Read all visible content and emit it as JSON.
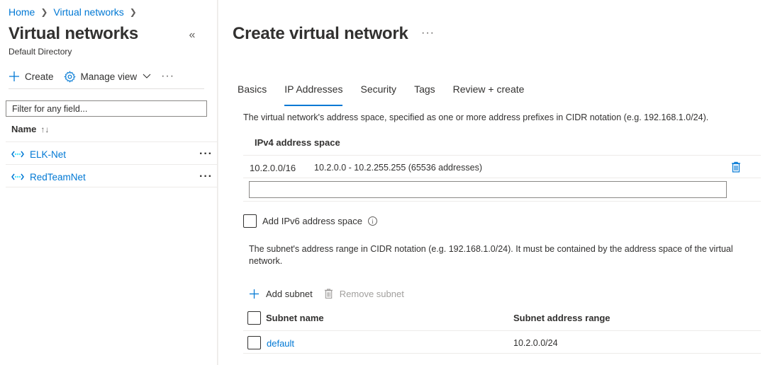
{
  "breadcrumb": {
    "home": "Home",
    "current": "Virtual networks"
  },
  "left_blade": {
    "title": "Virtual networks",
    "subtitle": "Default Directory",
    "commands": {
      "create": "Create",
      "manage_view": "Manage view"
    },
    "filter_placeholder": "Filter for any field...",
    "column_name": "Name",
    "items": [
      {
        "name": "ELK-Net"
      },
      {
        "name": "RedTeamNet"
      }
    ]
  },
  "right_blade": {
    "title": "Create virtual network",
    "tabs": [
      {
        "label": "Basics",
        "active": false
      },
      {
        "label": "IP Addresses",
        "active": true
      },
      {
        "label": "Security",
        "active": false
      },
      {
        "label": "Tags",
        "active": false
      },
      {
        "label": "Review + create",
        "active": false
      }
    ],
    "address_space_description": "The virtual network's address space, specified as one or more address prefixes in CIDR notation (e.g. 192.168.1.0/24).",
    "ipv4_header": "IPv4 address space",
    "ipv4_rows": [
      {
        "prefix": "10.2.0.0/16",
        "range": "10.2.0.0 - 10.2.255.255 (65536 addresses)"
      }
    ],
    "new_address_value": "",
    "ipv6_label": "Add IPv6 address space",
    "subnet_description": "The subnet's address range in CIDR notation (e.g. 192.168.1.0/24). It must be contained by the address space of the virtual network.",
    "add_subnet": "Add subnet",
    "remove_subnet": "Remove subnet",
    "subnet_table": {
      "headers": {
        "name": "Subnet name",
        "range": "Subnet address range"
      },
      "rows": [
        {
          "name": "default",
          "range": "10.2.0.0/24"
        }
      ]
    }
  },
  "colors": {
    "accent": "#0078d4",
    "text": "#323130",
    "disabled": "#a19f9d"
  }
}
